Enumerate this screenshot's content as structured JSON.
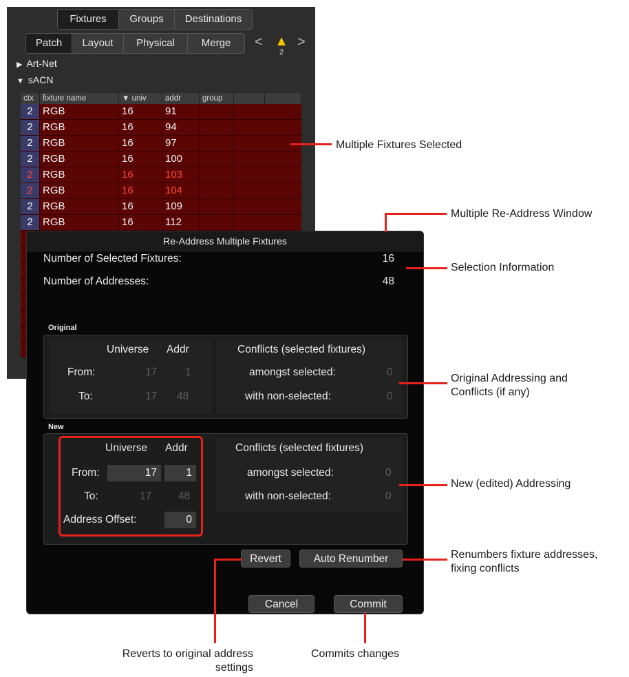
{
  "patch": {
    "top_tabs": [
      "Fixtures",
      "Groups",
      "Destinations"
    ],
    "sub_tabs": [
      "Patch",
      "Layout",
      "Physical",
      "Merge"
    ],
    "nav_prev": "<",
    "nav_next": ">",
    "warning_icon": "warning-triangle",
    "warning_count": "2",
    "tree": {
      "artnet": "Art-Net",
      "sacn": "sACN"
    },
    "columns": [
      "ctx",
      "fixture name",
      "univ",
      "addr",
      "group"
    ],
    "sort_indicator": "▼",
    "rows": [
      {
        "ctx": "2",
        "name": "RGB",
        "univ": "16",
        "addr": "91",
        "conflict": false
      },
      {
        "ctx": "2",
        "name": "RGB",
        "univ": "16",
        "addr": "94",
        "conflict": false
      },
      {
        "ctx": "2",
        "name": "RGB",
        "univ": "16",
        "addr": "97",
        "conflict": false
      },
      {
        "ctx": "2",
        "name": "RGB",
        "univ": "16",
        "addr": "100",
        "conflict": false
      },
      {
        "ctx": "2",
        "name": "RGB",
        "univ": "16",
        "addr": "103",
        "conflict": true
      },
      {
        "ctx": "2",
        "name": "RGB",
        "univ": "16",
        "addr": "104",
        "conflict": true
      },
      {
        "ctx": "2",
        "name": "RGB",
        "univ": "16",
        "addr": "109",
        "conflict": false
      },
      {
        "ctx": "2",
        "name": "RGB",
        "univ": "16",
        "addr": "112",
        "conflict": false
      }
    ]
  },
  "dialog": {
    "title": "Re-Address Multiple Fixtures",
    "selected_label": "Number of Selected Fixtures:",
    "selected_value": "16",
    "addresses_label": "Number of Addresses:",
    "addresses_value": "48",
    "original": {
      "section": "Original",
      "universe_header": "Universe",
      "addr_header": "Addr",
      "from_label": "From:",
      "to_label": "To:",
      "from_universe": "17",
      "from_addr": "1",
      "to_universe": "17",
      "to_addr": "48",
      "conflicts_header": "Conflicts (selected fixtures)",
      "amongst_label": "amongst selected:",
      "amongst_value": "0",
      "nonselected_label": "with non-selected:",
      "nonselected_value": "0"
    },
    "new": {
      "section": "New",
      "universe_header": "Universe",
      "addr_header": "Addr",
      "from_label": "From:",
      "to_label": "To:",
      "from_universe": "17",
      "from_addr": "1",
      "to_universe": "17",
      "to_addr": "48",
      "offset_label": "Address Offset:",
      "offset_value": "0",
      "conflicts_header": "Conflicts (selected fixtures)",
      "amongst_label": "amongst selected:",
      "amongst_value": "0",
      "nonselected_label": "with non-selected:",
      "nonselected_value": "0"
    },
    "revert_label": "Revert",
    "auto_label": "Auto Renumber",
    "cancel_label": "Cancel",
    "commit_label": "Commit"
  },
  "annotations": {
    "fixtures_selected": "Multiple Fixtures Selected",
    "readdress_window": "Multiple Re-Address Window",
    "selection_info": "Selection Information",
    "original_addressing_1": "Original Addressing and",
    "original_addressing_2": "Conflicts (if any)",
    "new_addressing": "New (edited) Addressing",
    "renumbers_1": "Renumbers fixture addresses,",
    "renumbers_2": "fixing conflicts",
    "reverts_1": "Reverts to original address",
    "reverts_2": "settings",
    "commits": "Commits changes"
  },
  "colors": {
    "accent_red": "#e8201a",
    "row_selected": "#5c0505",
    "conflict_text": "#ff4a3a",
    "warning": "#f3c400"
  }
}
